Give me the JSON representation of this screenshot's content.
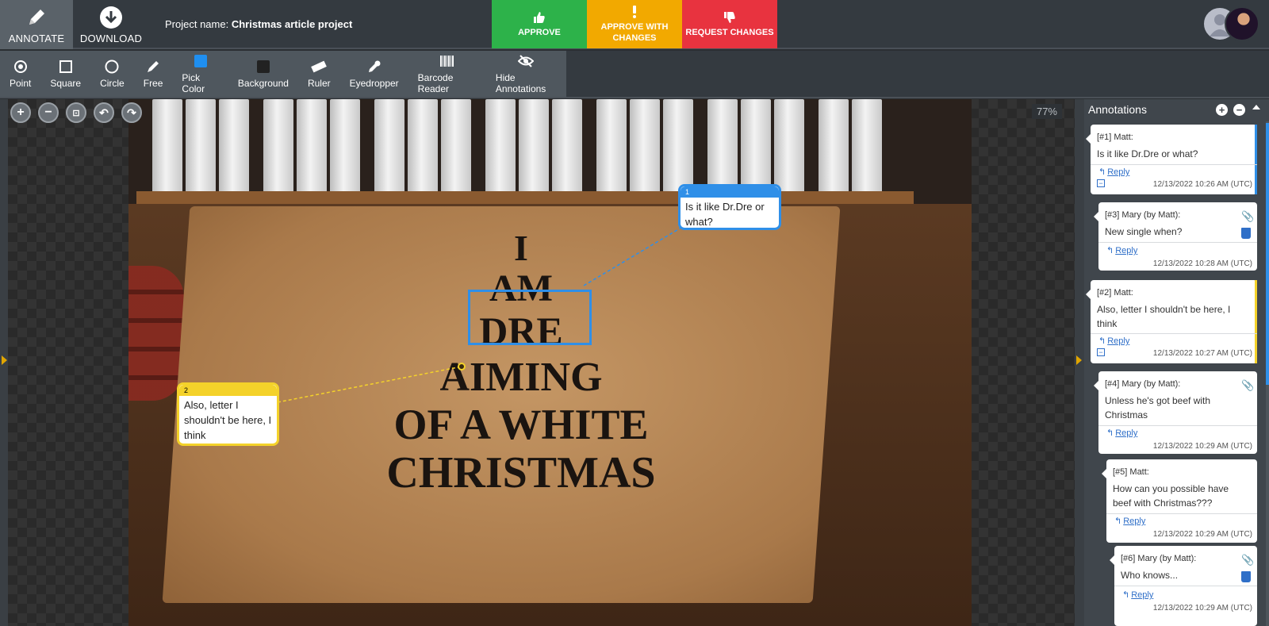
{
  "header": {
    "annotate_label": "ANNOTATE",
    "download_label": "DOWNLOAD",
    "project_prefix": "Project name:",
    "project_name": "Christmas article project",
    "approve_label": "APPROVE",
    "approve_changes_label": "APPROVE WITH CHANGES",
    "request_changes_label": "REQUEST CHANGES"
  },
  "tools": [
    {
      "label": "Point",
      "icon": "point-icon"
    },
    {
      "label": "Square",
      "icon": "square-icon"
    },
    {
      "label": "Circle",
      "icon": "circle-icon"
    },
    {
      "label": "Free",
      "icon": "pen-icon"
    },
    {
      "label": "Pick Color",
      "icon": "color-swatch-icon",
      "color": "#1f8ff0"
    },
    {
      "label": "Background",
      "icon": "background-swatch-icon",
      "color": "#222222"
    },
    {
      "label": "Ruler",
      "icon": "ruler-icon"
    },
    {
      "label": "Eyedropper",
      "icon": "eyedropper-icon"
    },
    {
      "label": "Barcode Reader",
      "icon": "barcode-icon"
    },
    {
      "label": "Hide Annotations",
      "icon": "eye-slash-icon"
    }
  ],
  "canvas": {
    "zoom": "77%",
    "mat_lines": [
      "I",
      "AM",
      "DRE",
      "AIMING",
      "OF A WHITE",
      "CHRISTMAS"
    ],
    "annotation_1": {
      "number": "1",
      "text": "Is it like Dr.Dre or what?",
      "color": "#2f8fe8"
    },
    "annotation_2": {
      "number": "2",
      "text": "Also, letter I shouldn't be here, I think",
      "color": "#f4d22a"
    }
  },
  "panel": {
    "title": "Annotations",
    "comments": [
      {
        "author": "[#1] Matt:",
        "body": "Is it like Dr.Dre or what?",
        "reply": "Reply",
        "date": "12/13/2022 10:26 AM (UTC)"
      },
      {
        "author": "[#3] Mary (by Matt):",
        "body": "New single when?",
        "reply": "Reply",
        "date": "12/13/2022 10:28 AM (UTC)"
      },
      {
        "author": "[#2] Matt:",
        "body": "Also, letter I shouldn't be here, I think",
        "reply": "Reply",
        "date": "12/13/2022 10:27 AM (UTC)"
      },
      {
        "author": "[#4] Mary (by Matt):",
        "body": "Unless he's got beef with Christmas",
        "reply": "Reply",
        "date": "12/13/2022 10:29 AM (UTC)"
      },
      {
        "author": "[#5] Matt:",
        "body": "How can you possible have beef with Christmas???",
        "reply": "Reply",
        "date": "12/13/2022 10:29 AM (UTC)"
      },
      {
        "author": "[#6] Mary (by Matt):",
        "body": "Who knows...",
        "reply": "Reply",
        "date": "12/13/2022 10:29 AM (UTC)"
      }
    ]
  },
  "colors": {
    "approve": "#2db24a",
    "approve_changes": "#f2a900",
    "request_changes": "#e8333f",
    "accent": "#2f8fe8"
  }
}
